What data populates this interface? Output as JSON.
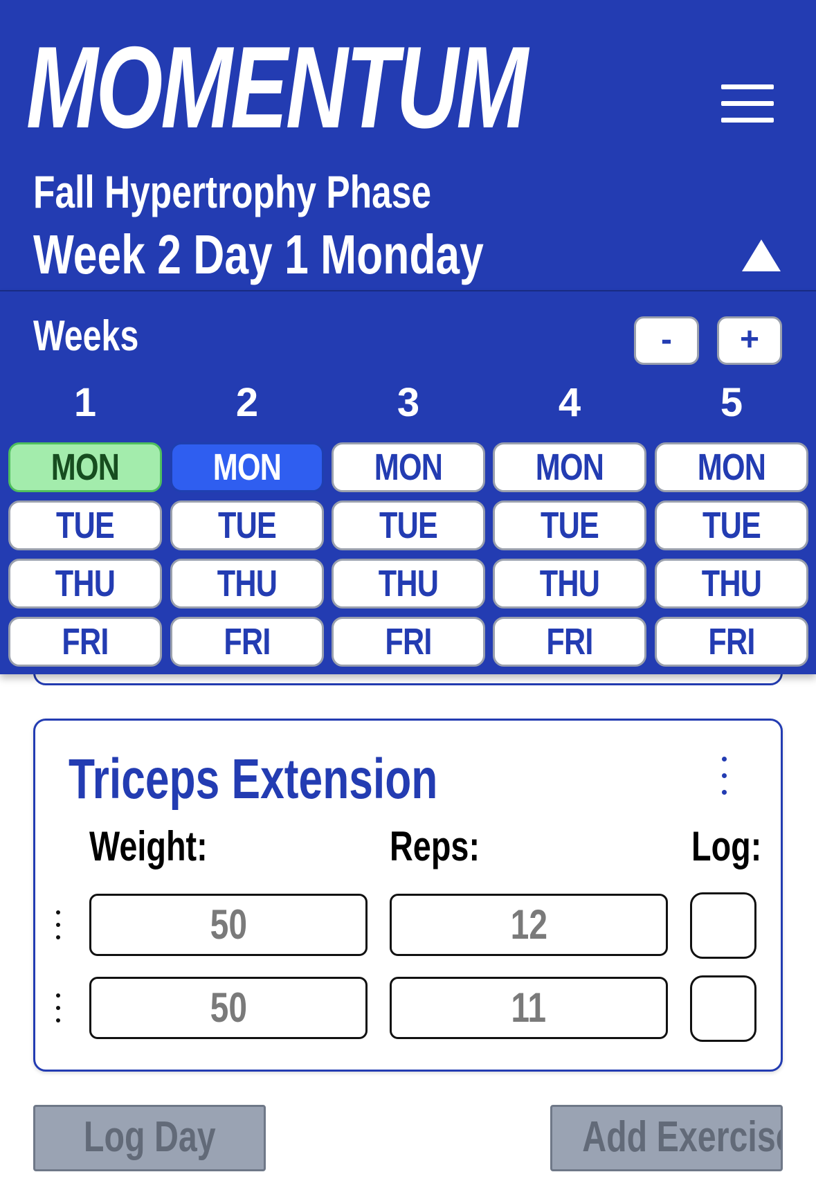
{
  "app": {
    "title": "MOMENTUM"
  },
  "header": {
    "phase": "Fall Hypertrophy Phase",
    "day_title": "Week 2 Day 1 Monday",
    "menu_icon": "hamburger-menu-icon",
    "collapse_icon": "triangle-up-icon"
  },
  "weeks": {
    "label": "Weeks",
    "minus_label": "-",
    "plus_label": "+",
    "columns": [
      {
        "number": "1",
        "days": [
          "MON",
          "TUE",
          "THU",
          "FRI"
        ]
      },
      {
        "number": "2",
        "days": [
          "MON",
          "TUE",
          "THU",
          "FRI"
        ]
      },
      {
        "number": "3",
        "days": [
          "MON",
          "TUE",
          "THU",
          "FRI"
        ]
      },
      {
        "number": "4",
        "days": [
          "MON",
          "TUE",
          "THU",
          "FRI"
        ]
      },
      {
        "number": "5",
        "days": [
          "MON",
          "TUE",
          "THU",
          "FRI"
        ]
      }
    ],
    "completed_day": "Week 1 MON",
    "selected_day": "Week 2 MON",
    "colors": {
      "panel": "#233cb2",
      "completed": "#a3ecac",
      "selected": "#2f5ef0"
    }
  },
  "exercise": {
    "name": "Triceps Extension",
    "weight_label": "Weight:",
    "reps_label": "Reps:",
    "log_label": "Log:",
    "sets": [
      {
        "weight": "50",
        "reps": "12",
        "logged": false
      },
      {
        "weight": "50",
        "reps": "11",
        "logged": false
      }
    ]
  },
  "actions": {
    "log_day": "Log Day",
    "add_exercise": "Add Exercise"
  }
}
